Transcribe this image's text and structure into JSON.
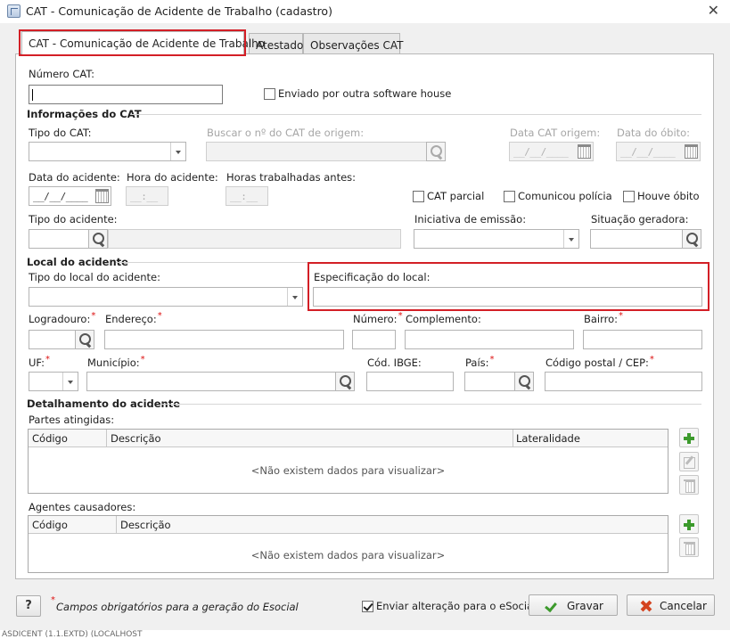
{
  "window": {
    "title": "CAT - Comunicação de Acidente de Trabalho (cadastro)",
    "close": "✕"
  },
  "tabs": [
    {
      "label": "CAT - Comunicação de Acidente de Trabalho"
    },
    {
      "label": "Atestado"
    },
    {
      "label": "Observações CAT"
    }
  ],
  "form": {
    "numero_cat_label": "Número CAT:",
    "enviado_label": "Enviado por outra software house",
    "info_section": "Informações do CAT",
    "tipo_cat_label": "Tipo do CAT:",
    "buscar_label": "Buscar o nº do CAT de origem:",
    "data_cat_origem_label": "Data CAT origem:",
    "data_obito_label": "Data do óbito:",
    "date_mask": "__/__/____",
    "time_mask": "__:__",
    "data_acidente_label": "Data do acidente:",
    "hora_acidente_label": "Hora do acidente:",
    "horas_trab_label": "Horas trabalhadas antes:",
    "cat_parcial_label": "CAT parcial",
    "comunicou_label": "Comunicou polícia",
    "houve_obito_label": "Houve óbito",
    "tipo_acidente_label": "Tipo do acidente:",
    "iniciativa_label": "Iniciativa de emissão:",
    "situacao_label": "Situação geradora:",
    "local_section": "Local do acidente",
    "tipo_local_label": "Tipo do local do acidente:",
    "especificacao_label": "Especificação do local:",
    "logradouro_label": "Logradouro:",
    "endereco_label": "Endereço:",
    "numero_label": "Número:",
    "complemento_label": "Complemento:",
    "bairro_label": "Bairro:",
    "uf_label": "UF:",
    "municipio_label": "Município:",
    "cod_ibge_label": "Cód. IBGE:",
    "pais_label": "País:",
    "cep_label": "Código postal / CEP:",
    "req": "*",
    "detalhamento_section": "Detalhamento do acidente",
    "partes_label": "Partes atingidas:",
    "agentes_label": "Agentes causadores:",
    "col_codigo": "Código",
    "col_descricao": "Descrição",
    "col_lateralidade": "Lateralidade",
    "empty_msg": "<Não existem dados para visualizar>"
  },
  "footer": {
    "help": "?",
    "required_note": "Campos obrigatórios para a geração do Esocial",
    "enviar_label": "Enviar alteração para o eSocial",
    "gravar_label": "Gravar",
    "cancelar_label": "Cancelar"
  },
  "statusbar": {
    "text": "ASDICENT (1.1.EXTD) (LOCALHOST"
  },
  "colors": {
    "highlight": "#d31f26",
    "accent_green": "#3c9a2c",
    "cancel_red": "#d4431f"
  }
}
